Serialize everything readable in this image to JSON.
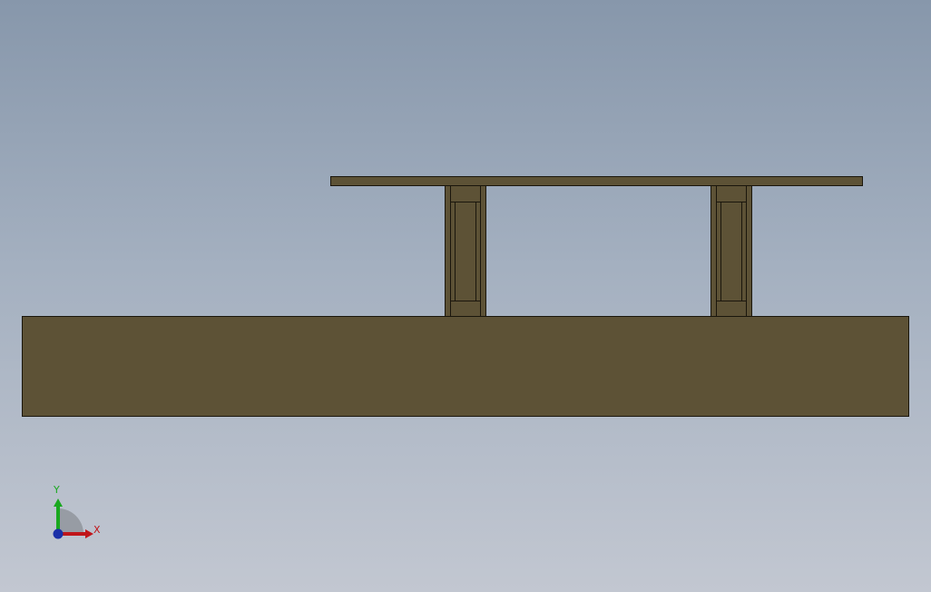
{
  "viewport": {
    "background_top": "#8797ab",
    "background_bottom": "#c2c7d1"
  },
  "model": {
    "body_color": "#5d5236",
    "edge_color": "#1a160c"
  },
  "triad": {
    "x_label": "X",
    "y_label": "Y",
    "x_color": "#c0151a",
    "y_color": "#19a81f",
    "z_color": "#1a2fa8"
  }
}
